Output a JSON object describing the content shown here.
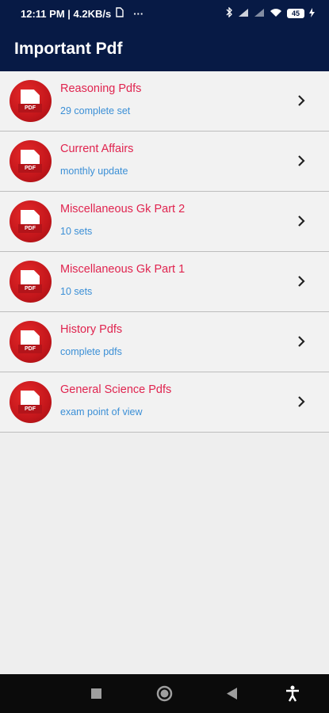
{
  "status_bar": {
    "time_speed": "12:11 PM | 4.2KB/s",
    "dots": "···",
    "battery": "45"
  },
  "app_bar": {
    "title": "Important Pdf"
  },
  "list": {
    "items": [
      {
        "title": "Reasoning Pdfs",
        "subtitle": "29 complete set"
      },
      {
        "title": "Current Affairs",
        "subtitle": "monthly update"
      },
      {
        "title": "Miscellaneous Gk Part 2",
        "subtitle": "10 sets"
      },
      {
        "title": "Miscellaneous Gk Part 1",
        "subtitle": "10 sets"
      },
      {
        "title": "History Pdfs",
        "subtitle": "complete pdfs"
      },
      {
        "title": "General Science Pdfs",
        "subtitle": "exam point of view"
      }
    ],
    "logo_tag": "PDF"
  },
  "colors": {
    "app_bar": "#071a45",
    "title_text": "#e0244f",
    "subtitle_text": "#3b8fd6",
    "logo_red": "#c4161b"
  },
  "icons": {
    "row_logo": "pdf-logo-icon",
    "row_arrow": "chevron-right-icon",
    "nav": [
      "square-recents-icon",
      "circle-home-icon",
      "triangle-back-icon",
      "accessibility-icon"
    ]
  }
}
